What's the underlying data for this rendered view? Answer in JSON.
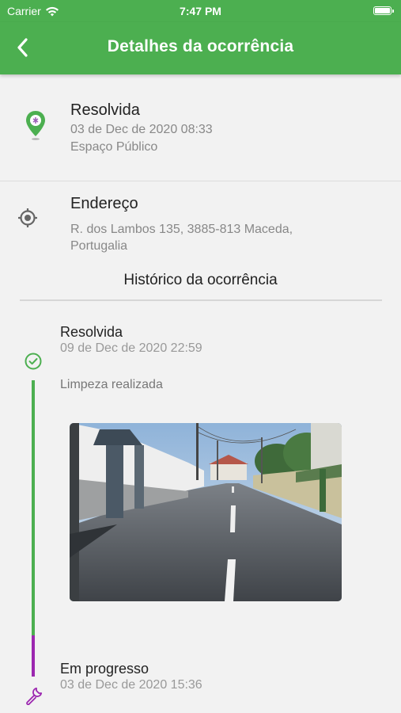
{
  "status_bar": {
    "carrier": "Carrier",
    "time": "7:47 PM"
  },
  "nav": {
    "title": "Detalhes da ocorrência",
    "back_icon": "chevron-left-icon"
  },
  "occurrence": {
    "status": "Resolvida",
    "date": "03 de Dec de 2020 08:33",
    "category": "Espaço Público"
  },
  "address": {
    "label": "Endereço",
    "line1": "R. dos Lambos 135, 3885-813 Maceda,",
    "line2": "Portugalia"
  },
  "history": {
    "title": "Histórico da ocorrência",
    "events": [
      {
        "status": "Resolvida",
        "date": "09 de Dec de 2020 22:59",
        "note": "Limpeza realizada",
        "icon": "check-circle-icon",
        "color": "#4caf50"
      },
      {
        "status": "Em progresso",
        "date": "03 de Dec de 2020 15:36",
        "icon": "wrench-icon",
        "color": "#9c27b0"
      }
    ]
  },
  "colors": {
    "accent": "#4caf50",
    "progress": "#9c27b0"
  }
}
